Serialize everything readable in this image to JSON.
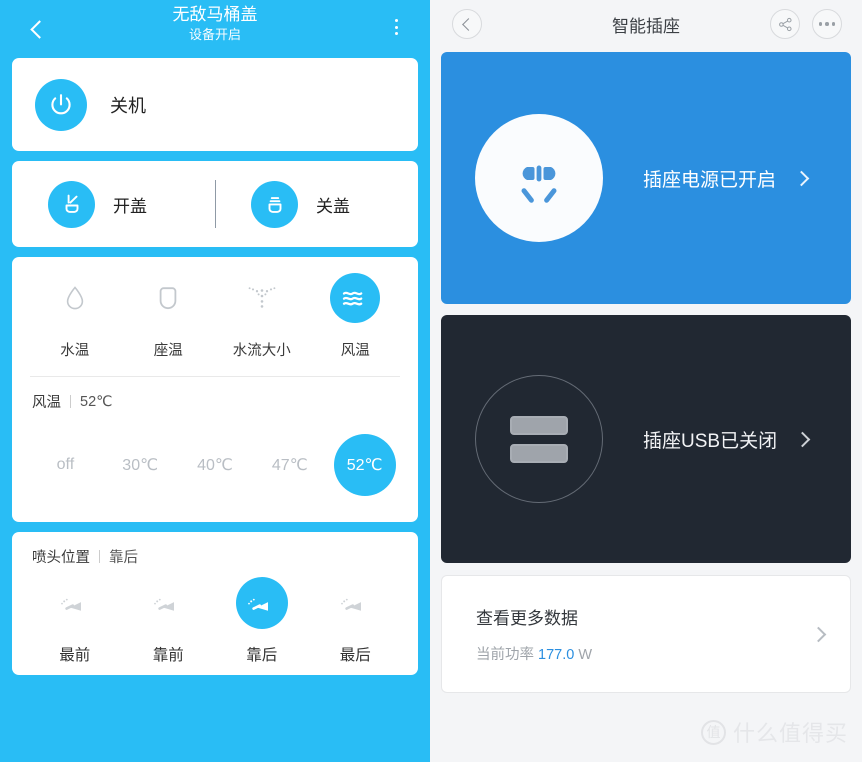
{
  "left": {
    "header": {
      "back_icon": "chevron-left-icon",
      "title": "无敌马桶盖",
      "subtitle": "设备开启",
      "menu_icon": "more-vertical-icon"
    },
    "power": {
      "icon": "power-icon",
      "label": "关机"
    },
    "lid": {
      "open": {
        "icon": "lid-open-icon",
        "label": "开盖"
      },
      "close": {
        "icon": "lid-close-icon",
        "label": "关盖"
      }
    },
    "modes": [
      {
        "icon": "water-drop-icon",
        "label": "水温",
        "active": false
      },
      {
        "icon": "seat-icon",
        "label": "座温",
        "active": false
      },
      {
        "icon": "spray-icon",
        "label": "水流大小",
        "active": false
      },
      {
        "icon": "wind-waves-icon",
        "label": "风温",
        "active": true
      }
    ],
    "temperature": {
      "title": "风温",
      "value": "52℃",
      "options": [
        "off",
        "30℃",
        "40℃",
        "47℃",
        "52℃"
      ],
      "selected_index": 4
    },
    "nozzle": {
      "title": "喷头位置",
      "value": "靠后",
      "options": [
        {
          "icon": "nozzle-icon",
          "label": "最前"
        },
        {
          "icon": "nozzle-icon",
          "label": "靠前"
        },
        {
          "icon": "nozzle-icon",
          "label": "靠后"
        },
        {
          "icon": "nozzle-icon",
          "label": "最后"
        }
      ],
      "selected_index": 2
    }
  },
  "right": {
    "header": {
      "back_icon": "chevron-left-icon",
      "title": "智能插座",
      "share_icon": "share-icon",
      "more_icon": "more-horizontal-icon"
    },
    "socket_card": {
      "icon": "power-outlet-icon",
      "status": "插座电源已开启",
      "chevron_icon": "chevron-right-icon"
    },
    "usb_card": {
      "icon": "usb-ports-icon",
      "status": "插座USB已关闭",
      "chevron_icon": "chevron-right-icon"
    },
    "data_card": {
      "title": "查看更多数据",
      "power_label": "当前功率",
      "power_value": "177.0",
      "power_unit": "W",
      "chevron_icon": "chevron-right-icon"
    },
    "watermark": {
      "badge": "值",
      "text": "什么值得买"
    }
  },
  "colors": {
    "left_bg": "#29bdf5",
    "accent_blue": "#29bdf5",
    "socket_blue": "#2b8fe0",
    "usb_dark": "#212832",
    "right_bg": "#f4f5f7"
  }
}
